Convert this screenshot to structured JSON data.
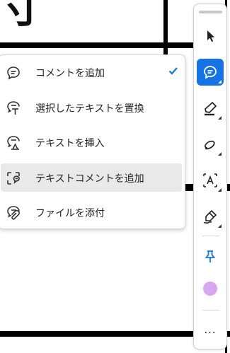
{
  "document": {
    "glyph": "寸"
  },
  "menu": {
    "items": [
      {
        "label": "コメントを追加",
        "icon": "comment-icon",
        "checked": true
      },
      {
        "label": "選択したテキストを置換",
        "icon": "replace-text-icon",
        "checked": false
      },
      {
        "label": "テキストを挿入",
        "icon": "insert-text-icon",
        "checked": false
      },
      {
        "label": "テキストコメントを追加",
        "icon": "text-comment-icon",
        "checked": false,
        "hovered": true
      },
      {
        "label": "ファイルを添付",
        "icon": "attach-file-icon",
        "checked": false
      }
    ]
  },
  "toolbar": {
    "tools": [
      {
        "name": "select-tool",
        "icon": "pointer-icon"
      },
      {
        "name": "comment-tool",
        "icon": "comment-icon",
        "active": true
      },
      {
        "name": "highlight-tool",
        "icon": "highlighter-icon"
      },
      {
        "name": "draw-tool",
        "icon": "freehand-icon"
      },
      {
        "name": "text-box-tool",
        "icon": "text-box-icon"
      },
      {
        "name": "signature-tool",
        "icon": "pen-sign-icon"
      },
      {
        "name": "pin-tool",
        "icon": "pin-icon"
      },
      {
        "name": "color-tool",
        "icon": "color-swatch-icon"
      },
      {
        "name": "more-tools",
        "icon": "ellipsis-icon",
        "label": "..."
      }
    ],
    "colors": {
      "accent": "#1473e6",
      "swatch": "#d9a6f2",
      "pin": "#1473e6"
    }
  }
}
